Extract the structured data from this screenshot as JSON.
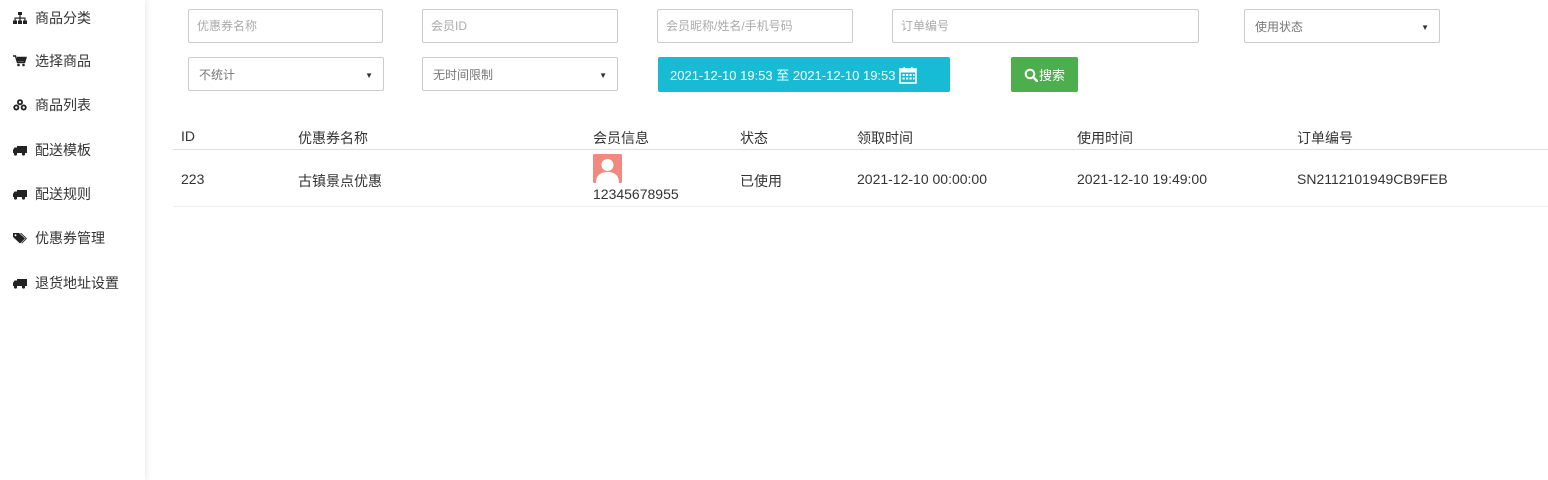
{
  "sidebar": {
    "items": [
      {
        "label": "商品分类",
        "icon": "sitemap-icon"
      },
      {
        "label": "选择商品",
        "icon": "cart-icon"
      },
      {
        "label": "商品列表",
        "icon": "cubes-icon"
      },
      {
        "label": "配送模板",
        "icon": "truck-icon"
      },
      {
        "label": "配送规则",
        "icon": "truck-icon"
      },
      {
        "label": "优惠券管理",
        "icon": "tags-icon"
      },
      {
        "label": "退货地址设置",
        "icon": "truck-icon"
      }
    ]
  },
  "filters": {
    "coupon_name_placeholder": "优惠券名称",
    "member_id_placeholder": "会员ID",
    "member_info_placeholder": "会员昵称/姓名/手机号码",
    "order_no_placeholder": "订单编号",
    "use_status_selected": "使用状态",
    "stat_selected": "不统计",
    "time_limit_selected": "无时间限制",
    "date_range": "2021-12-10 19:53 至 2021-12-10 19:53",
    "search_label": "搜索"
  },
  "table": {
    "headers": [
      "ID",
      "优惠券名称",
      "会员信息",
      "状态",
      "领取时间",
      "使用时间",
      "订单编号"
    ],
    "rows": [
      {
        "id": "223",
        "coupon_name": "古镇景点优惠",
        "member_phone": "12345678955",
        "status": "已使用",
        "receive_time": "2021-12-10 00:00:00",
        "use_time": "2021-12-10 19:49:00",
        "order_no": "SN2112101949CB9FEB"
      }
    ]
  },
  "colors": {
    "date_button": "#17bcd4",
    "search_button": "#4cae4c",
    "avatar": "#f08a80"
  }
}
